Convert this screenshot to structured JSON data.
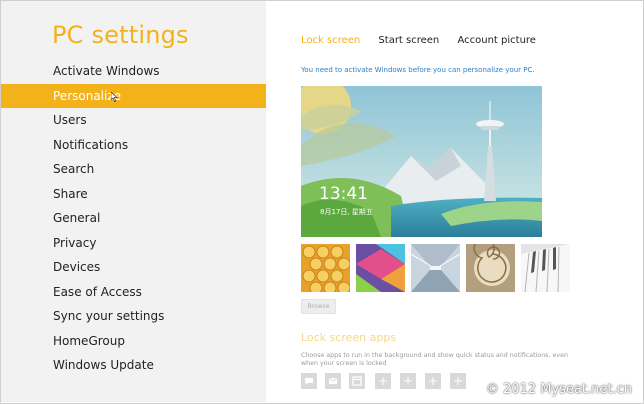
{
  "sidebar": {
    "title": "PC settings",
    "items": [
      {
        "label": "Activate Windows",
        "active": false
      },
      {
        "label": "Personalize",
        "active": true
      },
      {
        "label": "Users",
        "active": false
      },
      {
        "label": "Notifications",
        "active": false
      },
      {
        "label": "Search",
        "active": false
      },
      {
        "label": "Share",
        "active": false
      },
      {
        "label": "General",
        "active": false
      },
      {
        "label": "Privacy",
        "active": false
      },
      {
        "label": "Devices",
        "active": false
      },
      {
        "label": "Ease of Access",
        "active": false
      },
      {
        "label": "Sync your settings",
        "active": false
      },
      {
        "label": "HomeGroup",
        "active": false
      },
      {
        "label": "Windows Update",
        "active": false
      }
    ]
  },
  "tabs": [
    {
      "label": "Lock screen",
      "active": true
    },
    {
      "label": "Start screen",
      "active": false
    },
    {
      "label": "Account picture",
      "active": false
    }
  ],
  "notice": "You need to activate Windows before you can personalize your PC.",
  "preview": {
    "time": "13:41",
    "date": "8月17日, 星期五"
  },
  "browse_label": "Browse",
  "lock_apps": {
    "heading": "Lock screen apps",
    "description": "Choose apps to run in the background and show quick status and notifications, even when your screen is locked",
    "slots": [
      "chat-icon",
      "mail-icon",
      "calendar-icon",
      "plus-icon",
      "plus-icon",
      "plus-icon",
      "plus-icon"
    ]
  },
  "watermark": "© 2012 Myseat.net.cn",
  "colors": {
    "accent": "#f3b21a",
    "link": "#2a7fc9",
    "sidebar_bg": "#f2f2f2"
  }
}
